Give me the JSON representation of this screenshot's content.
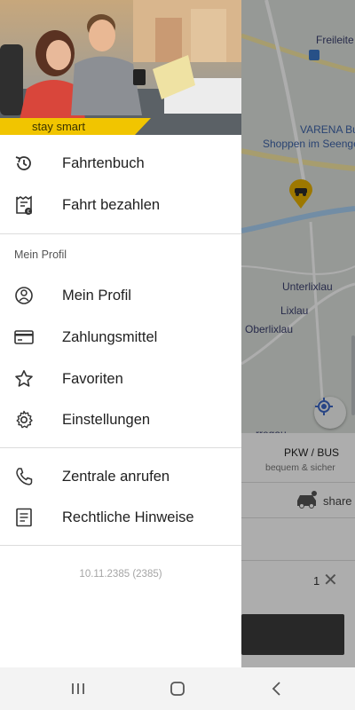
{
  "map": {
    "labels": [
      {
        "key": "freileite",
        "text": "Freileite"
      },
      {
        "key": "varena",
        "text": "VARENA Bu"
      },
      {
        "key": "shoppen",
        "text": "Shoppen im Seenge"
      },
      {
        "key": "unterlixlau",
        "text": "Unterlixlau"
      },
      {
        "key": "lixlau",
        "text": "Lixlau"
      },
      {
        "key": "oberlixlau",
        "text": "Oberlixlau"
      },
      {
        "key": "erregau",
        "text": "rregau"
      }
    ]
  },
  "bottom_sheet": {
    "vehicle_name": "PKW / BUS",
    "vehicle_desc": "bequem & sicher",
    "share_label": "share",
    "count": "1"
  },
  "drawer": {
    "slogan": "stay smart",
    "items_top": [
      {
        "label": "Fahrtenbuch",
        "icon": "history-icon"
      },
      {
        "label": "Fahrt bezahlen",
        "icon": "receipt-payment-icon"
      }
    ],
    "profile_section_header": "Mein Profil",
    "items_profile": [
      {
        "label": "Mein Profil",
        "icon": "profile-icon"
      },
      {
        "label": "Zahlungsmittel",
        "icon": "credit-card-icon"
      },
      {
        "label": "Favoriten",
        "icon": "star-icon"
      },
      {
        "label": "Einstellungen",
        "icon": "gear-icon"
      }
    ],
    "items_bottom": [
      {
        "label": "Zentrale anrufen",
        "icon": "phone-icon"
      },
      {
        "label": "Rechtliche Hinweise",
        "icon": "document-icon"
      }
    ],
    "version": "10.11.2385 (2385)"
  },
  "colors": {
    "brand_yellow": "#f1c500",
    "locate_blue": "#3b66c4"
  }
}
